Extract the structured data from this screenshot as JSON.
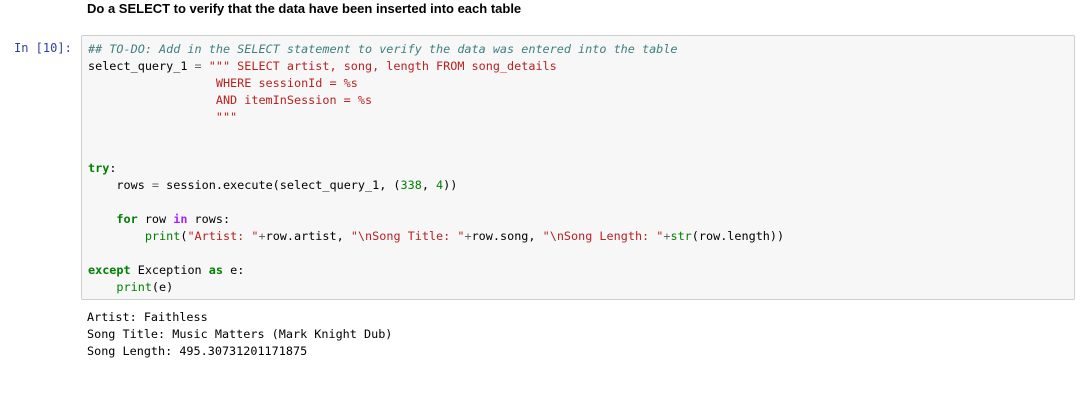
{
  "markdown": {
    "heading": "Do a SELECT to verify that the data have been inserted into each table"
  },
  "cell": {
    "prompt": "In [10]:",
    "code_lines": {
      "l1": "## TO-DO: Add in the SELECT statement to verify the data was entered into the table",
      "l2_var": "select_query_1",
      "l2_op": " = ",
      "l2_str": "\"\"\" SELECT artist, song, length FROM song_details",
      "l3_str": "                  WHERE sessionId = %s",
      "l4_str": "                  AND itemInSession = %s",
      "l5_str": "                  \"\"\"",
      "l8_kw": "try",
      "l8_rest": ":",
      "l9_a": "    rows ",
      "l9_op": "=",
      "l9_b": " session.execute(select_query_1, (",
      "l9_n1": "338",
      "l9_c": ", ",
      "l9_n2": "4",
      "l9_d": "))",
      "l11_kw": "    for",
      "l11_a": " row ",
      "l11_in": "in",
      "l11_b": " rows:",
      "l12_fn": "        print",
      "l12_a": "(",
      "l12_s1": "\"Artist: \"",
      "l12_op1": "+",
      "l12_b": "row.artist, ",
      "l12_s2": "\"\\nSong Title: \"",
      "l12_op2": "+",
      "l12_c": "row.song, ",
      "l12_s3": "\"\\nSong Length: \"",
      "l12_op3": "+",
      "l12_str": "str",
      "l12_d": "(row.length))",
      "l14_kw": "except",
      "l14_a": " Exception ",
      "l14_as": "as",
      "l14_b": " e:",
      "l15_fn": "    print",
      "l15_a": "(e)"
    }
  },
  "output": {
    "line1": "Artist: Faithless",
    "line2": "Song Title: Music Matters (Mark Knight Dub)",
    "line3": "Song Length: 495.30731201171875"
  }
}
